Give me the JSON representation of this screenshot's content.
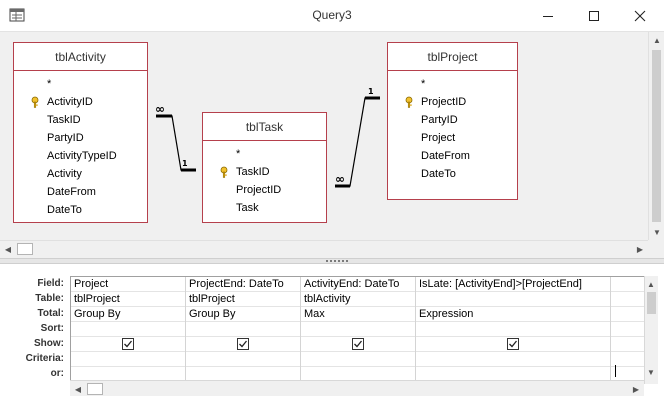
{
  "window": {
    "title": "Query3",
    "icons": {
      "app": "query-design-icon",
      "minimize": "minimize-icon",
      "maximize": "maximize-icon",
      "close": "close-icon"
    }
  },
  "tables": {
    "activity": {
      "name": "tblActivity",
      "fields": [
        {
          "label": "*",
          "key": false
        },
        {
          "label": "ActivityID",
          "key": true
        },
        {
          "label": "TaskID",
          "key": false
        },
        {
          "label": "PartyID",
          "key": false
        },
        {
          "label": "ActivityTypeID",
          "key": false
        },
        {
          "label": "Activity",
          "key": false
        },
        {
          "label": "DateFrom",
          "key": false
        },
        {
          "label": "DateTo",
          "key": false
        }
      ]
    },
    "task": {
      "name": "tblTask",
      "fields": [
        {
          "label": "*",
          "key": false
        },
        {
          "label": "TaskID",
          "key": true
        },
        {
          "label": "ProjectID",
          "key": false
        },
        {
          "label": "Task",
          "key": false
        }
      ]
    },
    "project": {
      "name": "tblProject",
      "fields": [
        {
          "label": "*",
          "key": false
        },
        {
          "label": "ProjectID",
          "key": true
        },
        {
          "label": "PartyID",
          "key": false
        },
        {
          "label": "Project",
          "key": false
        },
        {
          "label": "DateFrom",
          "key": false
        },
        {
          "label": "DateTo",
          "key": false
        }
      ]
    }
  },
  "relationships": [
    {
      "many_label": "∞",
      "one_label": "1"
    },
    {
      "many_label": "∞",
      "one_label": "1"
    }
  ],
  "grid": {
    "row_labels": [
      "Field:",
      "Table:",
      "Total:",
      "Sort:",
      "Show:",
      "Criteria:",
      "or:"
    ],
    "columns": [
      {
        "field": "Project",
        "table": "tblProject",
        "total": "Group By",
        "sort": "",
        "show": true,
        "criteria": "",
        "or": ""
      },
      {
        "field": "ProjectEnd: DateTo",
        "table": "tblProject",
        "total": "Group By",
        "sort": "",
        "show": true,
        "criteria": "",
        "or": ""
      },
      {
        "field": "ActivityEnd: DateTo",
        "table": "tblActivity",
        "total": "Max",
        "sort": "",
        "show": true,
        "criteria": "",
        "or": ""
      },
      {
        "field": "IsLate: [ActivityEnd]>[ProjectEnd]",
        "table": "",
        "total": "Expression",
        "sort": "",
        "show": true,
        "criteria": "",
        "or": ""
      },
      {
        "field": "",
        "table": "",
        "total": "",
        "sort": "",
        "show": false,
        "criteria": "",
        "or": ""
      }
    ]
  }
}
